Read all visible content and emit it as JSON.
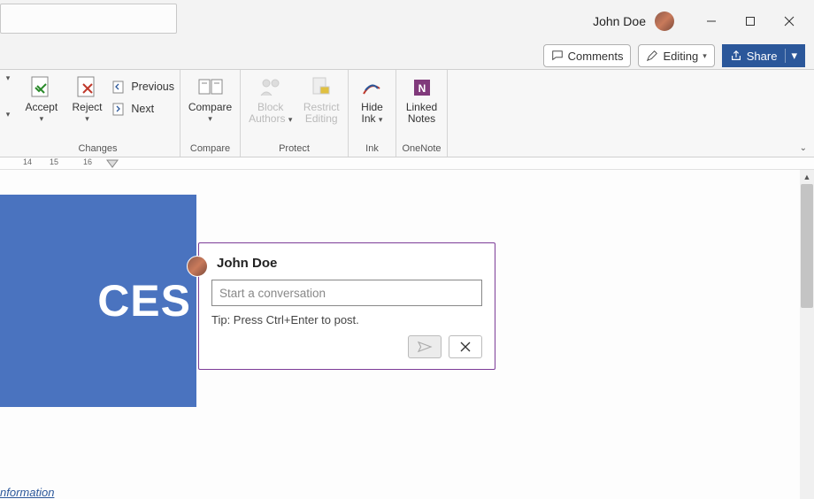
{
  "titlebar": {
    "user": "John Doe"
  },
  "actions": {
    "comments": "Comments",
    "editing": "Editing",
    "share": "Share"
  },
  "ribbon": {
    "changes": {
      "accept": "Accept",
      "reject": "Reject",
      "previous": "Previous",
      "next": "Next",
      "label": "Changes"
    },
    "compare": {
      "button": "Compare",
      "label": "Compare"
    },
    "protect": {
      "block": "Block",
      "authors": "Authors",
      "restrict": "Restrict",
      "editing": "Editing",
      "label": "Protect"
    },
    "ink": {
      "hide": "Hide",
      "ink": "Ink",
      "label": "Ink"
    },
    "onenote": {
      "linked": "Linked",
      "notes": "Notes",
      "label": "OneNote"
    }
  },
  "ruler": {
    "n14": "14",
    "n15": "15",
    "n16": "16"
  },
  "document": {
    "partial_heading": "CES",
    "footer_link": "nformation"
  },
  "comment": {
    "author": "John Doe",
    "placeholder": "Start a conversation",
    "tip": "Tip: Press Ctrl+Enter to post."
  }
}
